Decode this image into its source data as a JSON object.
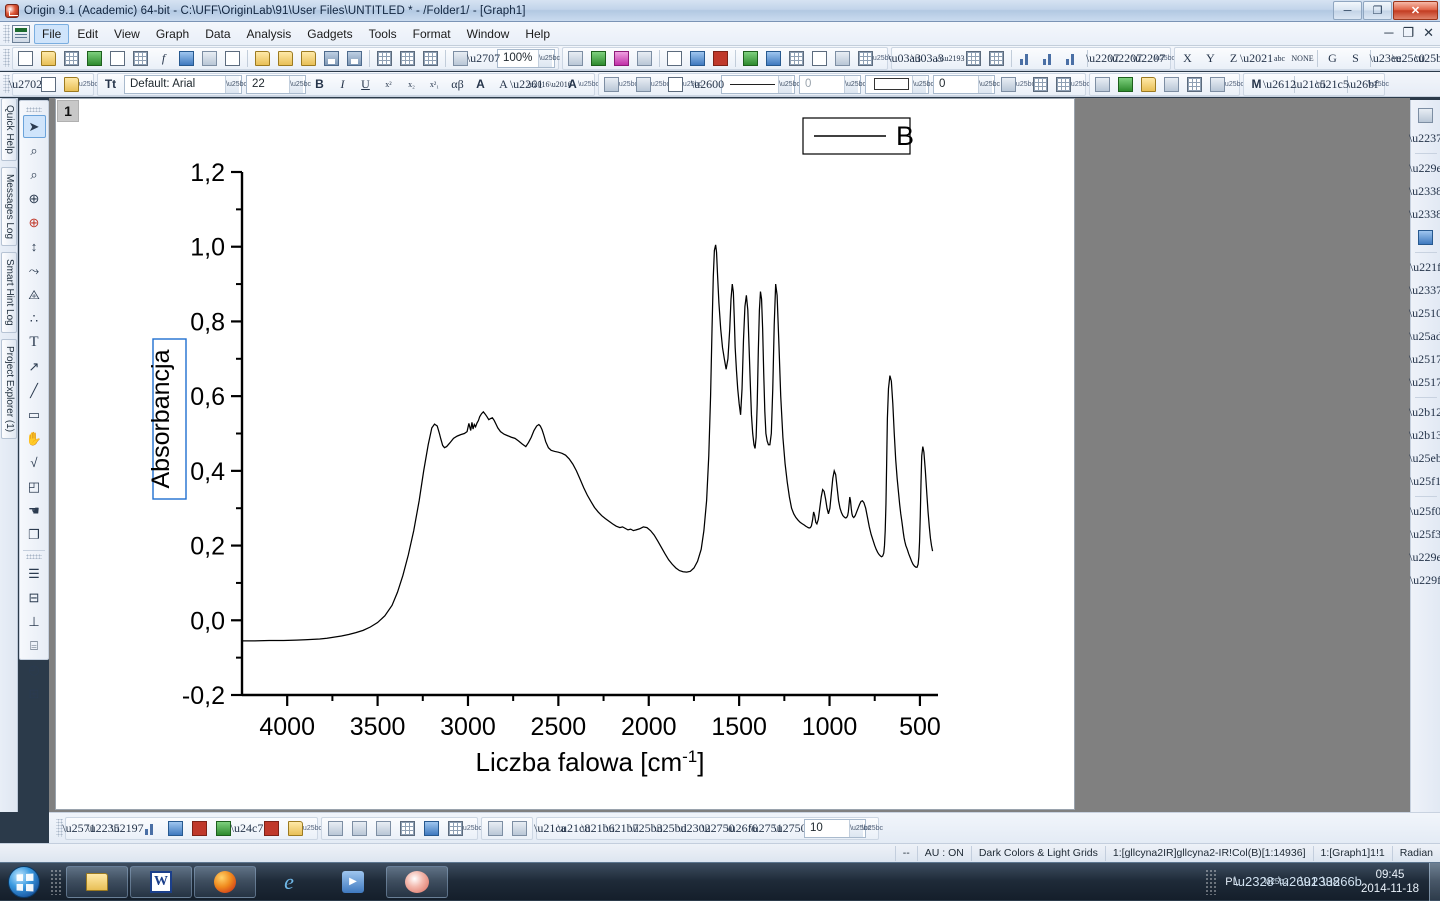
{
  "window": {
    "title": "Origin 9.1 (Academic) 64-bit - C:\\UFF\\OriginLab\\91\\User Files\\UNTITLED * - /Folder1/ - [Graph1]",
    "minimize": "─",
    "restore": "❐",
    "close": "✕",
    "mdi_minimize": "─",
    "mdi_restore": "❐",
    "mdi_close": "✕"
  },
  "menu": {
    "items": [
      {
        "label": "File",
        "active": true
      },
      {
        "label": "Edit",
        "active": false
      },
      {
        "label": "View",
        "active": false
      },
      {
        "label": "Graph",
        "active": false
      },
      {
        "label": "Data",
        "active": false
      },
      {
        "label": "Analysis",
        "active": false
      },
      {
        "label": "Gadgets",
        "active": false
      },
      {
        "label": "Tools",
        "active": false
      },
      {
        "label": "Format",
        "active": false
      },
      {
        "label": "Window",
        "active": false
      },
      {
        "label": "Help",
        "active": false
      }
    ]
  },
  "toolbars": {
    "zoom_value": "100%",
    "font_value": "Default: Arial",
    "font_size_value": "22",
    "line_width_value": "0",
    "fill_pattern_value": "0",
    "line_style_label": "line-style-sample",
    "fill_color_label": "white-fill-swatch",
    "axis_labels": [
      "X",
      "Y",
      "Z"
    ],
    "abc_label": "abc",
    "none_label": "NONE",
    "grid_letters": [
      "G",
      "S"
    ],
    "bold": "B",
    "italic": "I",
    "underline": "U",
    "superscript": "x²",
    "subscript": "x₂",
    "subsuper": "x²₁",
    "greek": "αβ",
    "increase_font": "A",
    "decrease_font": "A",
    "m_button": "M"
  },
  "left_dock": {
    "tabs": [
      {
        "label": "Quick Help"
      },
      {
        "label": "Messages Log"
      },
      {
        "label": "Smart Hint Log"
      },
      {
        "label": "Project Explorer (1)"
      }
    ]
  },
  "tools_palette": {
    "items": [
      {
        "name": "pointer-tool",
        "glyph": "➤",
        "selected": true
      },
      {
        "name": "zoom-in-tool",
        "glyph": "⌕",
        "selected": false
      },
      {
        "name": "zoom-out-tool",
        "glyph": "⌕",
        "selected": false
      },
      {
        "name": "screen-reader-tool",
        "glyph": "⊕",
        "selected": false
      },
      {
        "name": "data-reader-tool",
        "glyph": "⊕",
        "selected": false
      },
      {
        "name": "data-selector-tool",
        "glyph": "↕",
        "selected": false
      },
      {
        "name": "draw-data-tool",
        "glyph": "⤳",
        "selected": false
      },
      {
        "name": "regional-mask-tool",
        "glyph": "⨹",
        "selected": false
      },
      {
        "name": "scatter-tool",
        "glyph": "∴",
        "selected": false
      },
      {
        "name": "text-tool",
        "glyph": "T",
        "selected": false
      },
      {
        "name": "arrow-tool",
        "glyph": "↗",
        "selected": false
      },
      {
        "name": "line-tool",
        "glyph": "╱",
        "selected": false
      },
      {
        "name": "rectangle-tool",
        "glyph": "▭",
        "selected": false
      },
      {
        "name": "hand-tool",
        "glyph": "✋",
        "selected": false
      },
      {
        "name": "equation-tool",
        "glyph": "√",
        "selected": false
      },
      {
        "name": "region-tool",
        "glyph": "◰",
        "selected": false
      },
      {
        "name": "magnify-tool",
        "glyph": "☚",
        "selected": false
      },
      {
        "name": "layer-tool",
        "glyph": "❐",
        "selected": false
      }
    ],
    "second_group": [
      {
        "name": "line-style-tool",
        "glyph": "☰"
      },
      {
        "name": "label-tool",
        "glyph": "⊟"
      },
      {
        "name": "error-bar-tool",
        "glyph": "⊥"
      },
      {
        "name": "column-tool",
        "glyph": "⌸"
      },
      {
        "name": "clock-tool",
        "glyph": "◴"
      },
      {
        "name": "table-tool",
        "glyph": "⊞"
      }
    ]
  },
  "graph": {
    "layer_badge": "1",
    "legend_label": "B"
  },
  "chart_data": {
    "type": "line",
    "title": "",
    "xlabel": "Liczba falowa [cm-1]",
    "xlabel_base": "Liczba falowa [cm",
    "xlabel_sup": "-1",
    "xlabel_tail": "]",
    "ylabel": "Absorbancja",
    "ylabel_selected": true,
    "legend": [
      "B"
    ],
    "legend_position": "top-right",
    "grid": false,
    "x_reversed": true,
    "xlim": [
      4250,
      400
    ],
    "ylim": [
      -0.2,
      1.2
    ],
    "xticks": [
      4000,
      3500,
      3000,
      2500,
      2000,
      1500,
      1000,
      500
    ],
    "xticklabels": [
      "4000",
      "3500",
      "3000",
      "2500",
      "2000",
      "1500",
      "1000",
      "500"
    ],
    "yticks": [
      -0.2,
      0.0,
      0.2,
      0.4,
      0.6,
      0.8,
      1.0,
      1.2
    ],
    "yticklabels": [
      "-0,2",
      "0,0",
      "0,2",
      "0,4",
      "0,6",
      "0,8",
      "1,0",
      "1,2"
    ],
    "series": [
      {
        "name": "B",
        "color": "#000000",
        "x": [
          4250,
          4180,
          4100,
          4020,
          3950,
          3900,
          3860,
          3820,
          3780,
          3740,
          3700,
          3660,
          3620,
          3580,
          3540,
          3500,
          3460,
          3420,
          3390,
          3360,
          3330,
          3300,
          3270,
          3245,
          3220,
          3200,
          3185,
          3170,
          3158,
          3150,
          3140,
          3130,
          3118,
          3100,
          3080,
          3060,
          3040,
          3020,
          3005,
          2995,
          2985,
          2978,
          2972,
          2965,
          2958,
          2950,
          2942,
          2935,
          2925,
          2915,
          2905,
          2895,
          2885,
          2875,
          2865,
          2855,
          2845,
          2835,
          2820,
          2800,
          2780,
          2760,
          2740,
          2720,
          2700,
          2680,
          2665,
          2650,
          2635,
          2620,
          2608,
          2600,
          2590,
          2580,
          2570,
          2555,
          2540,
          2520,
          2500,
          2480,
          2460,
          2440,
          2420,
          2400,
          2380,
          2360,
          2340,
          2320,
          2300,
          2280,
          2260,
          2240,
          2220,
          2200,
          2180,
          2160,
          2145,
          2130,
          2115,
          2100,
          2085,
          2070,
          2050,
          2030,
          2010,
          1990,
          1970,
          1950,
          1930,
          1910,
          1890,
          1870,
          1850,
          1830,
          1810,
          1790,
          1770,
          1750,
          1730,
          1710,
          1695,
          1680,
          1668,
          1658,
          1650,
          1643,
          1637,
          1630,
          1625,
          1620,
          1612,
          1602,
          1592,
          1582,
          1572,
          1562,
          1552,
          1545,
          1538,
          1532,
          1527,
          1522,
          1515,
          1508,
          1500,
          1492,
          1484,
          1476,
          1468,
          1460,
          1452,
          1445,
          1438,
          1432,
          1425,
          1418,
          1412,
          1406,
          1400,
          1394,
          1388,
          1382,
          1376,
          1370,
          1364,
          1358,
          1352,
          1345,
          1338,
          1330,
          1322,
          1314,
          1306,
          1298,
          1290,
          1280,
          1270,
          1258,
          1246,
          1234,
          1222,
          1210,
          1198,
          1186,
          1174,
          1162,
          1150,
          1140,
          1132,
          1125,
          1118,
          1112,
          1106,
          1100,
          1094,
          1088,
          1082,
          1076,
          1070,
          1062,
          1054,
          1046,
          1038,
          1030,
          1022,
          1014,
          1006,
          998,
          990,
          982,
          974,
          966,
          958,
          950,
          942,
          934,
          926,
          918,
          912,
          906,
          900,
          896,
          892,
          888,
          884,
          880,
          876,
          872,
          866,
          858,
          850,
          842,
          834,
          826,
          818,
          810,
          800,
          790,
          780,
          770,
          760,
          750,
          742,
          734,
          726,
          718,
          712,
          706,
          700,
          696,
          692,
          688,
          684,
          680,
          674,
          666,
          658,
          650,
          642,
          634,
          626,
          618,
          612,
          606,
          600,
          596,
          592,
          588,
          584,
          578,
          570,
          562,
          554,
          546,
          538,
          530,
          522,
          516,
          510,
          506,
          502,
          498,
          494,
          490,
          484,
          478,
          470,
          462,
          455,
          448,
          442,
          436,
          430
        ],
        "y": [
          -0.055,
          -0.055,
          -0.054,
          -0.054,
          -0.053,
          -0.052,
          -0.051,
          -0.05,
          -0.048,
          -0.045,
          -0.042,
          -0.038,
          -0.033,
          -0.027,
          -0.018,
          -0.006,
          0.012,
          0.04,
          0.075,
          0.12,
          0.175,
          0.24,
          0.32,
          0.4,
          0.47,
          0.515,
          0.525,
          0.52,
          0.5,
          0.485,
          0.468,
          0.462,
          0.465,
          0.475,
          0.487,
          0.493,
          0.497,
          0.5,
          0.505,
          0.527,
          0.508,
          0.53,
          0.512,
          0.524,
          0.518,
          0.528,
          0.535,
          0.545,
          0.553,
          0.558,
          0.552,
          0.545,
          0.537,
          0.54,
          0.542,
          0.535,
          0.525,
          0.515,
          0.505,
          0.498,
          0.494,
          0.49,
          0.487,
          0.48,
          0.472,
          0.465,
          0.476,
          0.49,
          0.508,
          0.52,
          0.524,
          0.52,
          0.51,
          0.495,
          0.478,
          0.462,
          0.455,
          0.452,
          0.45,
          0.447,
          0.442,
          0.432,
          0.418,
          0.4,
          0.378,
          0.355,
          0.335,
          0.318,
          0.302,
          0.29,
          0.28,
          0.272,
          0.265,
          0.258,
          0.252,
          0.248,
          0.25,
          0.246,
          0.242,
          0.244,
          0.24,
          0.242,
          0.245,
          0.25,
          0.248,
          0.24,
          0.228,
          0.212,
          0.195,
          0.178,
          0.162,
          0.15,
          0.14,
          0.133,
          0.13,
          0.129,
          0.131,
          0.14,
          0.158,
          0.19,
          0.24,
          0.32,
          0.44,
          0.6,
          0.78,
          0.92,
          0.99,
          1.005,
          0.985,
          0.93,
          0.85,
          0.78,
          0.73,
          0.7,
          0.672,
          0.7,
          0.78,
          0.86,
          0.9,
          0.878,
          0.81,
          0.73,
          0.67,
          0.62,
          0.58,
          0.55,
          0.62,
          0.75,
          0.84,
          0.87,
          0.83,
          0.73,
          0.63,
          0.55,
          0.5,
          0.47,
          0.46,
          0.49,
          0.58,
          0.72,
          0.83,
          0.88,
          0.86,
          0.78,
          0.66,
          0.56,
          0.5,
          0.48,
          0.47,
          0.47,
          0.5,
          0.62,
          0.79,
          0.9,
          0.87,
          0.74,
          0.6,
          0.49,
          0.42,
          0.37,
          0.33,
          0.3,
          0.285,
          0.275,
          0.268,
          0.262,
          0.258,
          0.255,
          0.252,
          0.25,
          0.248,
          0.247,
          0.248,
          0.253,
          0.268,
          0.29,
          0.28,
          0.262,
          0.258,
          0.27,
          0.3,
          0.33,
          0.35,
          0.345,
          0.325,
          0.3,
          0.285,
          0.3,
          0.34,
          0.38,
          0.4,
          0.39,
          0.355,
          0.32,
          0.3,
          0.288,
          0.28,
          0.276,
          0.274,
          0.275,
          0.28,
          0.29,
          0.31,
          0.33,
          0.32,
          0.3,
          0.285,
          0.278,
          0.275,
          0.28,
          0.29,
          0.3,
          0.31,
          0.318,
          0.32,
          0.315,
          0.3,
          0.275,
          0.25,
          0.23,
          0.215,
          0.2,
          0.19,
          0.182,
          0.176,
          0.172,
          0.17,
          0.172,
          0.18,
          0.2,
          0.24,
          0.31,
          0.42,
          0.54,
          0.62,
          0.655,
          0.64,
          0.58,
          0.5,
          0.43,
          0.38,
          0.34,
          0.31,
          0.285,
          0.265,
          0.25,
          0.235,
          0.222,
          0.212,
          0.2,
          0.19,
          0.178,
          0.168,
          0.158,
          0.15,
          0.145,
          0.142,
          0.142,
          0.15,
          0.17,
          0.21,
          0.28,
          0.37,
          0.44,
          0.465,
          0.45,
          0.4,
          0.34,
          0.29,
          0.25,
          0.22,
          0.2,
          0.185,
          0.175,
          0.168,
          0.162,
          0.158,
          0.155,
          0.153,
          0.152,
          0.155,
          0.17,
          0.21,
          0.27,
          0.33,
          0.36,
          0.35,
          0.31,
          0.26,
          0.22,
          0.19,
          0.172,
          0.162,
          0.155,
          0.15,
          0.148,
          0.15,
          0.16,
          0.2,
          0.27,
          0.38,
          0.49,
          0.57,
          0.6,
          0.59,
          0.54,
          0.47,
          0.4,
          0.34,
          0.3,
          0.27,
          0.248,
          0.23,
          0.215,
          0.2,
          0.19,
          0.182,
          0.175,
          0.17,
          0.168,
          0.17,
          0.175
        ]
      }
    ]
  },
  "bottom_toolbar": {
    "value": "10"
  },
  "statusbar": {
    "cells": [
      "--",
      "AU : ON",
      "Dark Colors & Light Grids",
      "1:[gllcyna2IR]gllcyna2-IR!Col(B)[1:14936]",
      "1:[Graph1]1!1",
      "Radian"
    ]
  },
  "taskbar": {
    "items": [
      {
        "name": "explorer",
        "label": "file-explorer-icon"
      },
      {
        "name": "word",
        "label": "W"
      },
      {
        "name": "firefox",
        "label": "firefox-icon"
      },
      {
        "name": "internet-explorer",
        "label": "e"
      },
      {
        "name": "media-player",
        "label": "▶"
      },
      {
        "name": "origin",
        "label": "origin-icon"
      }
    ],
    "tray": {
      "language": "PL",
      "time": "09:45",
      "date": "2014-11-18"
    }
  }
}
